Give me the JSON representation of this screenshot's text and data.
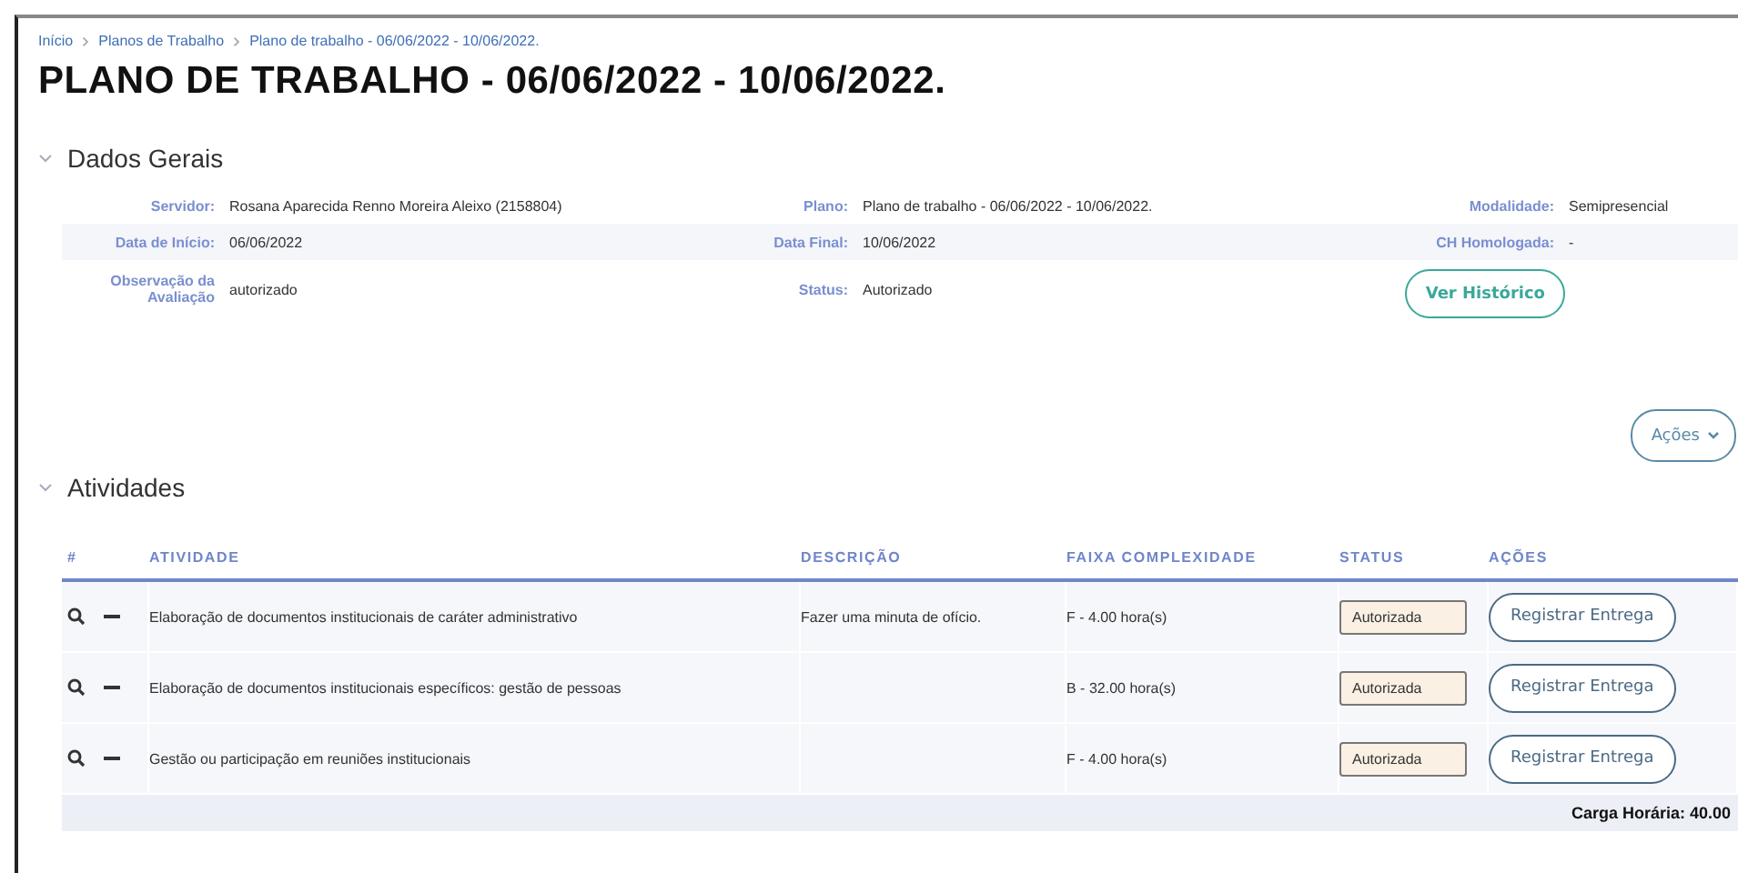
{
  "breadcrumb": [
    {
      "label": "Início"
    },
    {
      "label": "Planos de Trabalho"
    },
    {
      "label": "Plano de trabalho - 06/06/2022 - 10/06/2022."
    }
  ],
  "title": "PLANO DE TRABALHO - 06/06/2022 - 10/06/2022.",
  "general": {
    "heading": "Dados Gerais",
    "expanded": true,
    "rows": [
      {
        "striped": false,
        "fields": [
          {
            "label": "Servidor:",
            "value": "Rosana Aparecida Renno Moreira Aleixo (2158804)"
          },
          {
            "label": "Plano:",
            "value": "Plano de trabalho - 06/06/2022 - 10/06/2022."
          },
          {
            "label": "Modalidade:",
            "value": "Semipresencial"
          }
        ]
      },
      {
        "striped": true,
        "fields": [
          {
            "label": "Data de Início:",
            "value": "06/06/2022"
          },
          {
            "label": "Data Final:",
            "value": "10/06/2022"
          },
          {
            "label": "CH Homologada:",
            "value": "-"
          }
        ]
      },
      {
        "striped": false,
        "fields": [
          {
            "label": "Observação da Avaliação",
            "value": "autorizado"
          },
          {
            "label": "Status:",
            "value": "Autorizado"
          }
        ]
      }
    ],
    "history_button": "Ver Histórico",
    "actions_button": "Ações"
  },
  "activities": {
    "heading": "Atividades",
    "expanded": true,
    "columns": [
      "#",
      "ATIVIDADE",
      "DESCRIÇÃO",
      "FAIXA COMPLEXIDADE",
      "STATUS",
      "AÇÕES"
    ],
    "rows": [
      {
        "activity": "Elaboração de documentos institucionais de caráter administrativo",
        "description": "Fazer uma minuta de ofício.",
        "complexity": "F - 4.00 hora(s)",
        "status": "Autorizada",
        "action": "Registrar Entrega"
      },
      {
        "activity": "Elaboração de documentos institucionais específicos: gestão de pessoas",
        "complexity": "B - 32.00 hora(s)",
        "status": "Autorizada",
        "action": "Registrar Entrega"
      },
      {
        "activity": "Gestão ou participação em reuniões institucionais",
        "complexity": "F - 4.00 hora(s)",
        "status": "Autorizada",
        "action": "Registrar Entrega"
      }
    ],
    "total": "Carga Horária: 40.00"
  }
}
